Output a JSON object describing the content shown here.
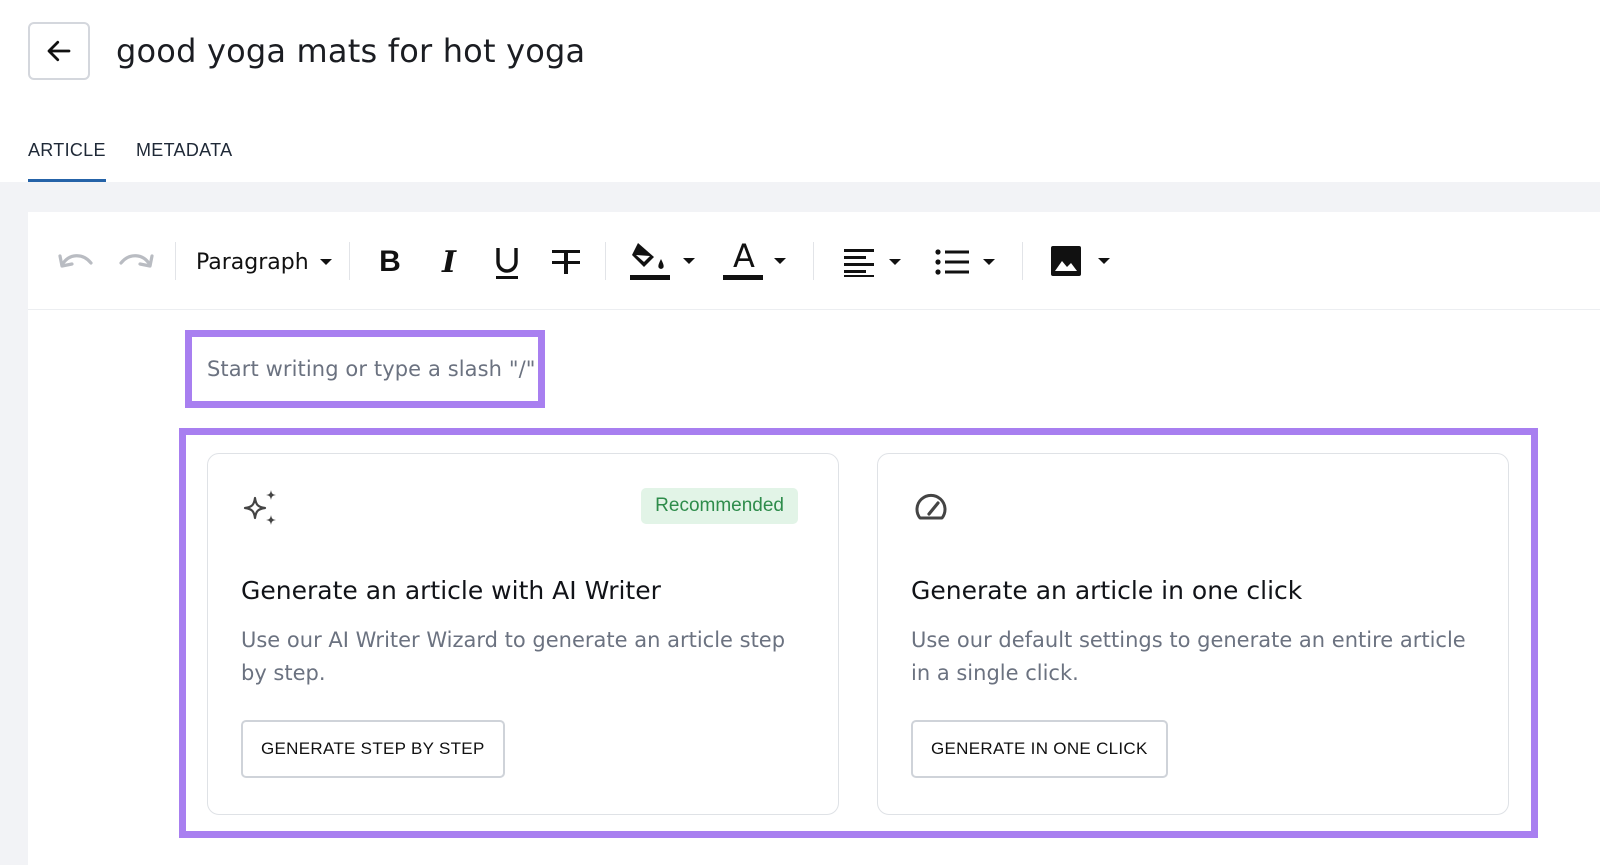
{
  "header": {
    "back_icon": "arrow-left-icon",
    "title": "good yoga mats for hot yoga"
  },
  "tabs": [
    {
      "label": "ARTICLE",
      "active": true
    },
    {
      "label": "METADATA",
      "active": false
    }
  ],
  "toolbar": {
    "undo_icon": "undo-icon",
    "redo_icon": "redo-icon",
    "block_format": "Paragraph",
    "bold_label": "B",
    "italic_label": "I",
    "underline_label": "U",
    "text_color_label": "A",
    "icons": [
      "bold-icon",
      "italic-icon",
      "underline-icon",
      "strikethrough-icon",
      "highlight-color-icon",
      "text-color-icon",
      "align-left-icon",
      "bullet-list-icon",
      "image-icon"
    ]
  },
  "editor": {
    "placeholder": "Start writing or type a slash \"/\""
  },
  "cards": [
    {
      "icon": "sparkles-icon",
      "badge": "Recommended",
      "title": "Generate an article with AI Writer",
      "description": "Use our AI Writer Wizard to generate an article step by step.",
      "button": "GENERATE STEP BY STEP"
    },
    {
      "icon": "speedometer-icon",
      "title": "Generate an article in one click",
      "description": "Use our default settings to generate an entire article in a single click.",
      "button": "GENERATE IN ONE CLICK"
    }
  ],
  "colors": {
    "highlight_outline": "#a87ff0",
    "tab_active": "#2563a8",
    "badge_bg": "#e2f4e7",
    "badge_text": "#2e8c4b",
    "workspace_bg": "#f2f3f6"
  }
}
